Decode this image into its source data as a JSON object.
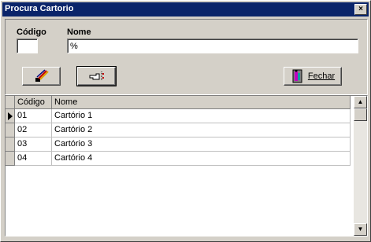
{
  "window": {
    "title": "Procura Cartorio",
    "close_label": "×"
  },
  "filters": {
    "codigo_label": "Código",
    "codigo_value": "",
    "nome_label": "Nome",
    "nome_value": "%"
  },
  "toolbar": {
    "clear_button": {
      "icon": "brush-icon"
    },
    "select_button": {
      "icon": "pointing-hand-icon"
    },
    "fechar_button": {
      "label": "Fechar",
      "icon": "exit-door-icon"
    }
  },
  "grid": {
    "columns": [
      "Código",
      "Nome"
    ],
    "rows": [
      {
        "codigo": "01",
        "nome": "Cartório 1"
      },
      {
        "codigo": "02",
        "nome": "Cartório 2"
      },
      {
        "codigo": "03",
        "nome": "Cartório 3"
      },
      {
        "codigo": "04",
        "nome": "Cartório 4"
      }
    ],
    "selected_row": 0
  }
}
